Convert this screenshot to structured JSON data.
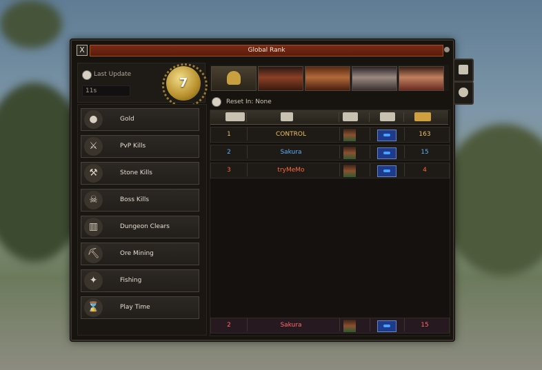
{
  "window": {
    "title": "Global Rank",
    "close_label": "X"
  },
  "update": {
    "label": "Last Update",
    "value": "11s",
    "badge": "7"
  },
  "categories": [
    {
      "label": "Gold",
      "icon": "gold-coins-icon",
      "glyph": "●"
    },
    {
      "label": "PvP Kills",
      "icon": "pvp-warrior-icon",
      "glyph": "⚔"
    },
    {
      "label": "Stone Kills",
      "icon": "stone-golem-icon",
      "glyph": "⚒"
    },
    {
      "label": "Boss Kills",
      "icon": "boss-skull-icon",
      "glyph": "☠"
    },
    {
      "label": "Dungeon Clears",
      "icon": "dungeon-gate-icon",
      "glyph": "▥"
    },
    {
      "label": "Ore Mining",
      "icon": "pickaxe-icon",
      "glyph": "⛏"
    },
    {
      "label": "Fishing",
      "icon": "fishing-icon",
      "glyph": "✦"
    },
    {
      "label": "Play Time",
      "icon": "hourglass-icon",
      "glyph": "⌛"
    }
  ],
  "reset": {
    "label": "Reset In: None"
  },
  "table": {
    "columns": [
      "rank-column",
      "name-column",
      "character-column",
      "guild-column",
      "score-column"
    ],
    "rows": [
      {
        "rank": "1",
        "name": "CONTROL",
        "score": "163",
        "color": "#f0c060"
      },
      {
        "rank": "2",
        "name": "Sakura",
        "score": "15",
        "color": "#58b0ff"
      },
      {
        "rank": "3",
        "name": "tryMeMo",
        "score": "4",
        "color": "#ff6a3a"
      }
    ],
    "self_row": {
      "rank": "2",
      "name": "Sakura",
      "score": "15",
      "color": "#ff6a6a"
    }
  }
}
